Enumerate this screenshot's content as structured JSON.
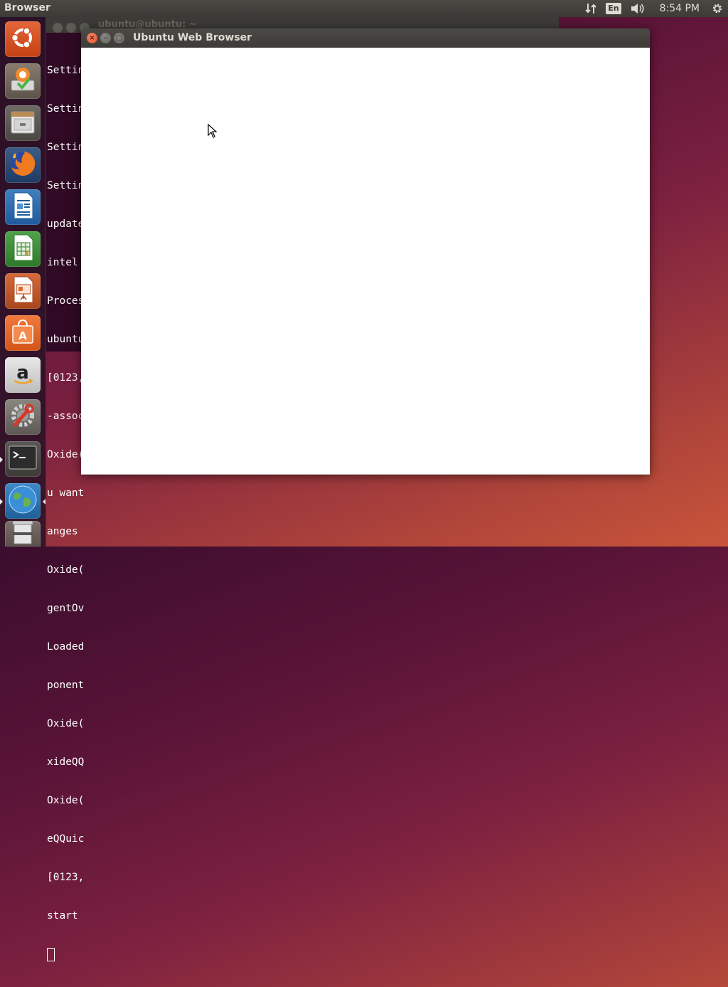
{
  "top_panel": {
    "app_title": "Browser",
    "keyboard_layout": "En",
    "clock": "8:54 PM",
    "icons": [
      "network-transfer-icon",
      "keyboard-layout-indicator",
      "volume-icon",
      "settings-gear-icon"
    ]
  },
  "launcher": {
    "items": [
      {
        "name": "ubuntu-dash",
        "icon": "ubuntu-logo-icon"
      },
      {
        "name": "software-updater",
        "icon": "software-updater-icon"
      },
      {
        "name": "files",
        "icon": "file-cabinet-icon"
      },
      {
        "name": "firefox",
        "icon": "firefox-icon"
      },
      {
        "name": "libreoffice-writer",
        "icon": "writer-document-icon"
      },
      {
        "name": "libreoffice-calc",
        "icon": "calc-spreadsheet-icon"
      },
      {
        "name": "libreoffice-impress",
        "icon": "impress-presentation-icon"
      },
      {
        "name": "ubuntu-software",
        "icon": "shopping-bag-icon"
      },
      {
        "name": "amazon",
        "icon": "amazon-icon"
      },
      {
        "name": "system-settings",
        "icon": "settings-wrench-icon"
      },
      {
        "name": "terminal",
        "icon": "terminal-icon"
      },
      {
        "name": "web-browser",
        "icon": "globe-icon"
      },
      {
        "name": "trash",
        "icon": "trash-icon"
      }
    ]
  },
  "terminal": {
    "title": "ubuntu@ubuntu: ~",
    "lines": [
      "Settin",
      "Settin",
      "Settin",
      "Settin",
      "update",
      "intel",
      "Proces",
      "ubuntu",
      "[0123,",
      "-assoc",
      "Oxide(",
      "u want",
      "anges",
      "Oxide(",
      "gentOv",
      "Loaded",
      "ponent",
      "Oxide(",
      "xideQQ",
      "Oxide(",
      "eQQuic",
      "[0123,",
      "start"
    ]
  },
  "browser": {
    "title": "Ubuntu Web Browser",
    "close_glyph": "×",
    "minimize_glyph": "–",
    "maximize_glyph": "□"
  }
}
